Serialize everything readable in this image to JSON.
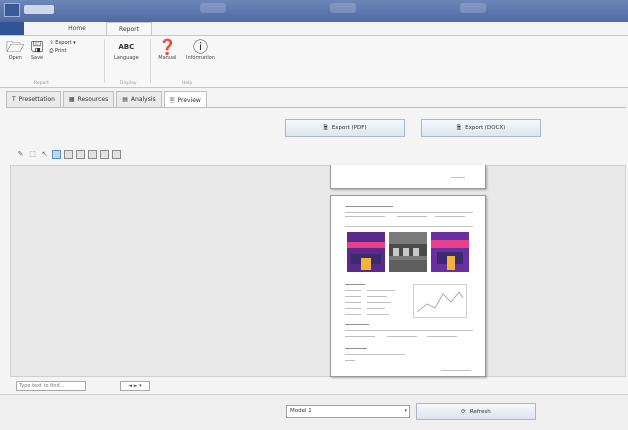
{
  "ribbon_tabs": {
    "file": "",
    "home": "Home",
    "report": "Report"
  },
  "ribbon": {
    "open_label": "Open",
    "save_label": "Save",
    "export_label": "Export",
    "print_label": "Print",
    "group_report": "Report",
    "language_label": "Language",
    "language_icon_text": "ABC",
    "group_display": "Display",
    "manual_label": "Manual",
    "information_label": "Information",
    "group_help": "Help"
  },
  "doc_tabs": [
    {
      "label": "Presettation",
      "icon": "t-icon"
    },
    {
      "label": "Resources",
      "icon": "grid-icon"
    },
    {
      "label": "Analysis",
      "icon": "chart-icon"
    },
    {
      "label": "Preview",
      "icon": "doc-icon"
    }
  ],
  "export": {
    "pdf_label": "Export (PDF)",
    "docx_label": "Export (DOCX)"
  },
  "bottom": {
    "search_placeholder": "Type text to find...",
    "nav_arrows": "◄ ► ▾",
    "mode_value": "Model 1",
    "refresh_label": "Refresh"
  },
  "colors": {
    "title_bar": "#5a75ad",
    "file_tab": "#2f5597",
    "thumb_purple": "#6a2fa0",
    "thumb_accent": "#e83f8a"
  }
}
